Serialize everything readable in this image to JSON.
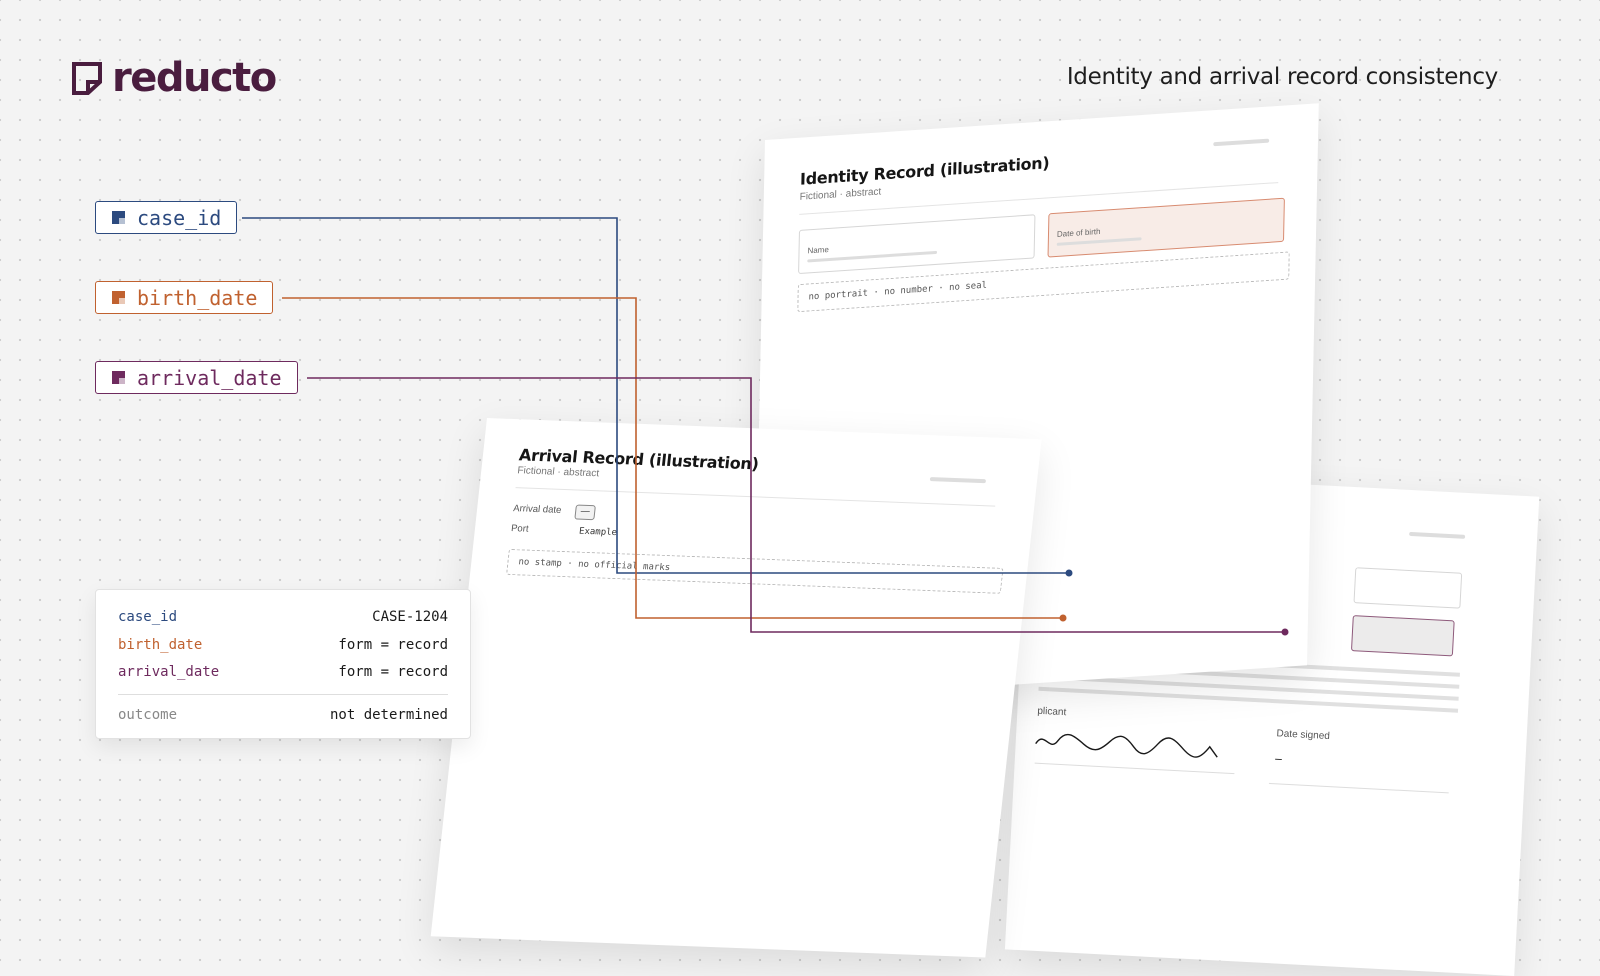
{
  "brand": {
    "name": "reducto",
    "color": "#4a1d3f"
  },
  "page_title": "Identity and arrival record consistency",
  "fields": [
    {
      "id": "case_id",
      "label": "case_id",
      "color": "#2c4a7f"
    },
    {
      "id": "birth_date",
      "label": "birth_date",
      "color": "#c0612f"
    },
    {
      "id": "arrival_date",
      "label": "arrival_date",
      "color": "#6e2a5e"
    }
  ],
  "identity_record": {
    "title": "Identity Record (illustration)",
    "subtitle": "Fictional · abstract",
    "fields": {
      "name_label": "Name",
      "dob_label": "Date of birth"
    },
    "note": "no portrait · no number · no seal"
  },
  "arrival_record": {
    "title": "Arrival Record (illustration)",
    "subtitle": "Fictional · abstract",
    "arrival_date_label": "Arrival date",
    "arrival_date_value": "—",
    "port_label": "Port",
    "port_value": "Example",
    "note": "no stamp · no official marks"
  },
  "back_document": {
    "applicant_label": "plicant",
    "date_signed_label": "Date signed",
    "date_signed_value": "–"
  },
  "summary": {
    "rows": [
      {
        "key": "case_id",
        "value": "CASE-1204",
        "color": "#2c4a7f"
      },
      {
        "key": "birth_date",
        "value": "form = record",
        "color": "#c0612f"
      },
      {
        "key": "arrival_date",
        "value": "form = record",
        "color": "#6e2a5e"
      }
    ],
    "outcome": {
      "key": "outcome",
      "value": "not determined"
    }
  }
}
